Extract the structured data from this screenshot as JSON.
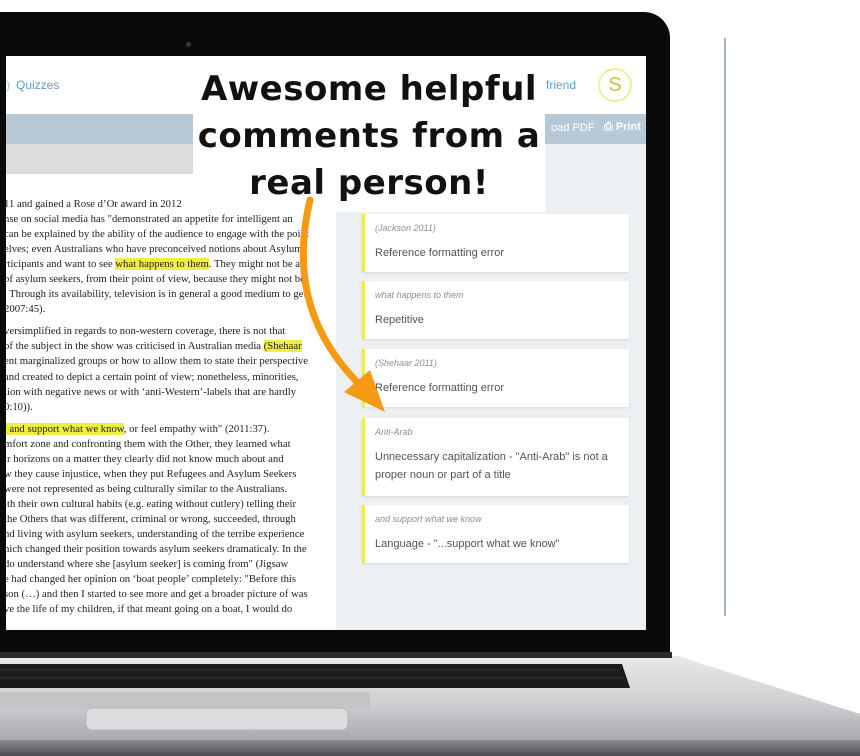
{
  "app": {
    "nav_quizzes": "Quizzes",
    "nav_friend": "friend",
    "avatar_initial": "S",
    "download_pdf": "oad PDF",
    "print": "Print"
  },
  "callout": {
    "text": "Awesome helpful comments from a real person!"
  },
  "document": {
    "paragraphs": [
      [
        {
          "t": "11 and gained a Rose d’Or award in 2012"
        },
        {
          "t": "nse on social media has \"demonstrated an appetite for intelligent an"
        },
        {
          "t": "can be explained by the ability of the audience to engage with the point"
        },
        {
          "t": "elves; even Australians who have preconceived notions about Asylum"
        },
        {
          "t": "rticipants and want to see ",
          "h": "what happens to them",
          "t2": ". They might not be as"
        },
        {
          "t": "of asylum seekers, from their point of view, because they might not be"
        },
        {
          "t": ". Through its availability, television is in general a good medium to get"
        },
        {
          "t": " 2007:45)."
        }
      ],
      [
        {
          "t": "versimplified in regards to non-western coverage, there is not that"
        },
        {
          "t": " of the subject in the show was criticised in Australian media ",
          "h": "(Shehaar"
        },
        {
          "t": "ent marginalized groups or how to allow them to state their perspective"
        },
        {
          "t": " and created to depict a certain point of view; nonetheless, minorities,"
        },
        {
          "t": "tion with negative news or with ‘anti-Western’-labels that are hardly"
        },
        {
          "t": "0:10))."
        }
      ],
      [
        {
          "t": "",
          "h": ", and support what we know",
          "t2": ", or feel empathy with\" (2011:37)."
        },
        {
          "t": "mfort zone and confronting them with the Other, they learned what"
        },
        {
          "t": "ir horizons on a matter they clearly did not know much about and"
        },
        {
          "t": "w they cause injustice, when they put Refugees and Asylum Seekers"
        },
        {
          "t": " were not represented as being culturally similar to the Australians."
        },
        {
          "t": "ith their own cultural habits (e.g. eating without cutlery) telling their"
        },
        {
          "t": " the Others that was different, criminal or wrong, succeeded, through"
        },
        {
          "t": "nd living with asylum seekers, understanding of the terribe experience"
        },
        {
          "t": "hich changed their position towards asylum seekers dramaticaly. In the"
        },
        {
          "t": " do understand where she [asylum seeker] is coming from\" (Jigsaw"
        },
        {
          "t": "e had changed her opinion on ‘boat people’ completely: \"Before this"
        },
        {
          "t": "son (…) and then I started to see more and get a broader picture of was"
        },
        {
          "t": "ve the life of my children, if that meant going on a boat, I would do"
        }
      ]
    ]
  },
  "comments": [
    {
      "quote": "(Jackson 2011)",
      "comment": "Reference formatting error"
    },
    {
      "quote": "what happens to them",
      "comment": "Repetitive"
    },
    {
      "quote": "(Shehaar 2011)",
      "comment": "Reference formatting error"
    },
    {
      "quote": "Anti-Arab",
      "comment": "Unnecessary capitalization - \"Anti-Arab\" is not a proper noun or part of a title"
    },
    {
      "quote": "and support what we know",
      "comment": "Language - \"...support what we know\""
    }
  ],
  "colors": {
    "highlight": "#f0ef3d",
    "accent_blue": "#5e9ec4",
    "arrow_orange": "#f59a12",
    "card_bar": "#f0ea56"
  },
  "icons": {
    "print": "printer-icon",
    "laptop": "laptop-icon"
  }
}
